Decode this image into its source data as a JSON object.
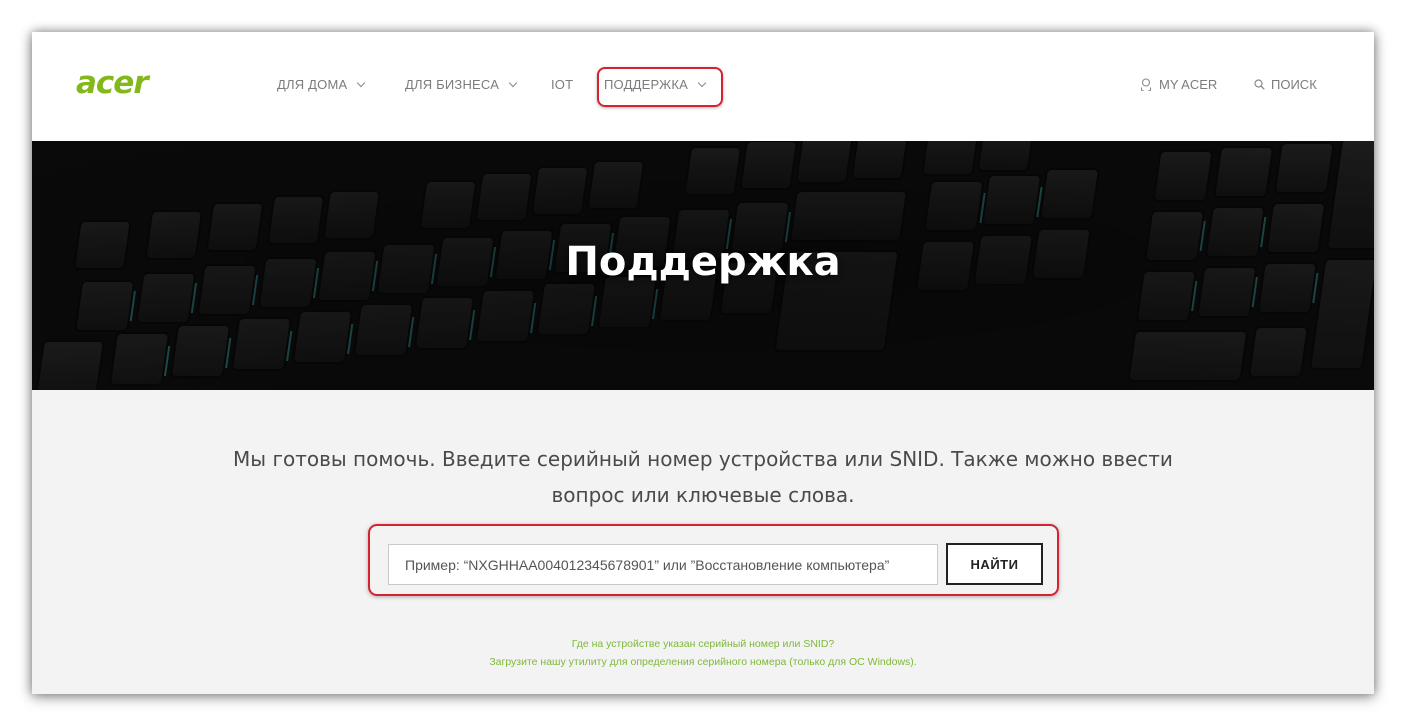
{
  "brand": {
    "logo_text": "acer",
    "accent": "#83b81a",
    "highlight": "#d4232e"
  },
  "nav": {
    "items": [
      {
        "label": "ДЛЯ ДОМА",
        "has_dropdown": true
      },
      {
        "label": "ДЛЯ БИЗНЕСА",
        "has_dropdown": true
      },
      {
        "label": "IOT",
        "has_dropdown": false
      },
      {
        "label": "ПОДДЕРЖКА",
        "has_dropdown": true,
        "highlighted": true
      }
    ],
    "my_acer": {
      "label": "MY ACER",
      "icon": "user-icon"
    },
    "search": {
      "label": "ПОИСК",
      "icon": "search-icon"
    }
  },
  "hero": {
    "title": "Поддержка"
  },
  "main": {
    "lead_line1": "Мы готовы помочь. Введите серийный номер устройства или SNID. Также можно ввести",
    "lead_line2": "вопрос или ключевые слова.",
    "search": {
      "placeholder": "Пример: “NXGHHAA004012345678901” или ”Восстановление компьютера”",
      "value": "",
      "button_label": "НАЙТИ"
    },
    "help_links": [
      "Где на устройстве указан серийный номер или SNID?",
      "Загрузите нашу утилиту для определения серийного номера (только для ОС Windows)."
    ]
  }
}
